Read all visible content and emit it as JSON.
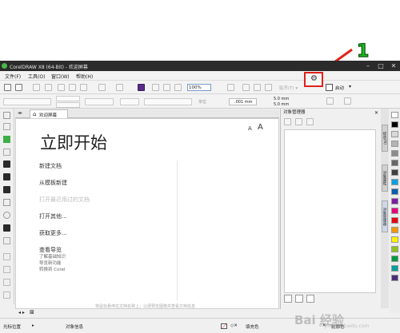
{
  "annotation": {
    "number": "1"
  },
  "window": {
    "title": "CorelDRAW X8 (64-Bit) - 欢迎屏幕",
    "controls": {
      "minimize": "–",
      "maximize": "□",
      "close": "✕"
    }
  },
  "menu": [
    "文件(F)",
    "工具(O)",
    "窗口(W)",
    "帮助(H)"
  ],
  "toolbar": {
    "zoom_value": "100%",
    "snap_label": "贴齐(T) ▾",
    "launch_label": "启动"
  },
  "property_bar": {
    "nudge_value": ".001 mm",
    "dup_x": "5.0 mm",
    "dup_y": "5.0 mm",
    "units_label": "单位"
  },
  "tab": {
    "label": "欢迎屏幕"
  },
  "welcome": {
    "font_small": "A",
    "font_large": "A",
    "title": "立即开始",
    "links": [
      "新建文档",
      "从模板新建",
      "打开最近用过的文档",
      "打开其他...",
      "获取更多...",
      "查看导览"
    ],
    "sublinks": [
      "了解基础知识",
      "导览新功能",
      "转换到 Corel"
    ],
    "footer_note": "将鼠标悬停在文档名称上，以便预览图像并查看文档信息"
  },
  "docker": {
    "title": "对象管理器",
    "close": "✕",
    "vtabs": [
      "提示(N)",
      "对象属性",
      "对象管理器"
    ]
  },
  "palette": {
    "colors": [
      "#ffffff",
      "#000000",
      "#d9d9d9",
      "#b3b3b3",
      "#8c8c8c",
      "#666666",
      "#404040",
      "#00a3e0",
      "#0060b0",
      "#7a1fa2",
      "#e4007f",
      "#e60012",
      "#f39800",
      "#fff100",
      "#8fc31f",
      "#009944",
      "#00a0a0",
      "#4a2d7a"
    ]
  },
  "status": {
    "cursor_label": "光标位置",
    "object_info": "对象信息",
    "fill_label": "填充色",
    "outline_label": "轮廓色"
  },
  "watermark": {
    "text": "Bai 经验",
    "sub": "jingyan.baidu.com"
  }
}
